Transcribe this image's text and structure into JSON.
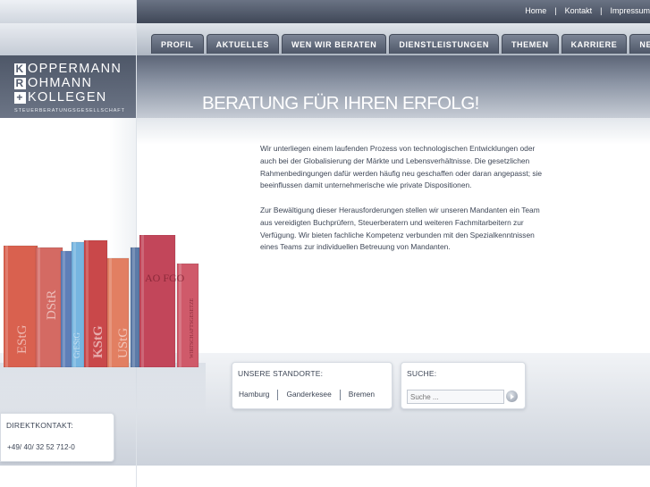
{
  "top_links": [
    "Home",
    "Kontakt",
    "Impressum"
  ],
  "top_link_separator": "|",
  "nav": [
    "PROFIL",
    "AKTUELLES",
    "WEN WIR BERATEN",
    "DIENSTLEISTUNGEN",
    "THEMEN",
    "KARRIERE",
    "NEWS"
  ],
  "logo": {
    "line1_cap": "K",
    "line1_rest": "OPPERMANN",
    "line2_cap": "R",
    "line2_rest": "OHMANN",
    "line3_cap": "+",
    "line3_rest": "KOLLEGEN",
    "subline": "STEUERBERATUNGSGESELLSCHAFT"
  },
  "slogan": "BERATUNG FÜR IHREN ERFOLG!",
  "content": {
    "para1": "Wir unterliegen einem laufenden Prozess von technologischen Entwicklungen oder auch bei der Globalisierung der Märkte und Lebensverhältnisse. Die gesetzlichen Rahmenbedingungen dafür werden häufig neu geschaffen oder daran angepasst; sie beeinflussen damit unternehmerische wie private Dispositionen.",
    "para2": "Zur Bewältigung dieser Herausforderungen stellen wir unseren Mandanten ein Team aus vereidigten Buchprüfern, Steuerberatern und weiteren Fachmitarbeitern zur Verfügung. Wir bieten fachliche Kompetenz verbunden mit den Spezialkenntnissen eines Teams zur individuellen Betreuung von Mandanten."
  },
  "books": {
    "labels": [
      "EStG",
      "DStR",
      "GrEStG",
      "KStG",
      "UStG",
      "AO FGO",
      "WIRTSCHAFTSGESETZE"
    ],
    "colors": [
      "#d9614f",
      "#d46a63",
      "#5f7fb8",
      "#76b5e0",
      "#c9484a",
      "#e27f62",
      "#5c7aa8",
      "#c2465a",
      "#cf5a6a"
    ]
  },
  "standorte": {
    "title": "UNSERE STANDORTE:",
    "locations": [
      "Hamburg",
      "Ganderkesee",
      "Bremen"
    ]
  },
  "suche": {
    "title": "SUCHE:",
    "placeholder": "Suche ..."
  },
  "direktkontakt": {
    "title": "DIREKTKONTAKT:",
    "phone": "+49/ 40/ 32 52 712-0"
  }
}
